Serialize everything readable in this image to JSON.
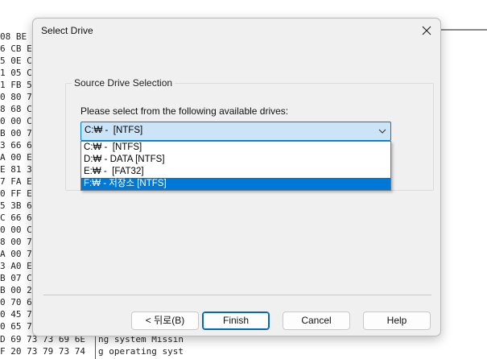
{
  "background": {
    "hex_lines": [
      "08 BE C",
      "6 CB E",
      "5 0E C",
      "1 05 C",
      "1 FB 5",
      "0 80 7",
      "8 68 C",
      "0 00 C",
      "B 00 7",
      "3 66 6",
      "A 00 E",
      "E 81 3",
      "7 FA E",
      "0 FF E",
      "5 3B 6",
      "C 66 6",
      "0 00 C",
      "8 00 7",
      "A 00 7",
      "3 A0 E",
      "B 07 C",
      "B 00 2",
      "0 70 6",
      "0 45 7",
      "0 65 7",
      "D 69 73 73 69 6E",
      "F 20 73 79 73 74"
    ],
    "ascii_lines": [
      "ng system Missin",
      "g operating syst"
    ]
  },
  "dialog": {
    "title": "Select Drive",
    "group_title": "Source Drive Selection",
    "prompt": "Please select from the following available drives:",
    "selected_value": "C:₩ -  [NTFS]",
    "drives": [
      {
        "label": "C:₩ -  [NTFS]",
        "selected": false
      },
      {
        "label": "D:₩ - DATA [NTFS]",
        "selected": false
      },
      {
        "label": "E:₩ -  [FAT32]",
        "selected": false
      },
      {
        "label": "F:₩ - 저장소 [NTFS]",
        "selected": true
      }
    ],
    "buttons": {
      "back": "< 뒤로(B)",
      "finish": "Finish",
      "cancel": "Cancel",
      "help": "Help"
    }
  },
  "colors": {
    "accent": "#0078d7",
    "combo_fill": "#cce4f7",
    "dialog_bg": "#f0f0f0"
  }
}
